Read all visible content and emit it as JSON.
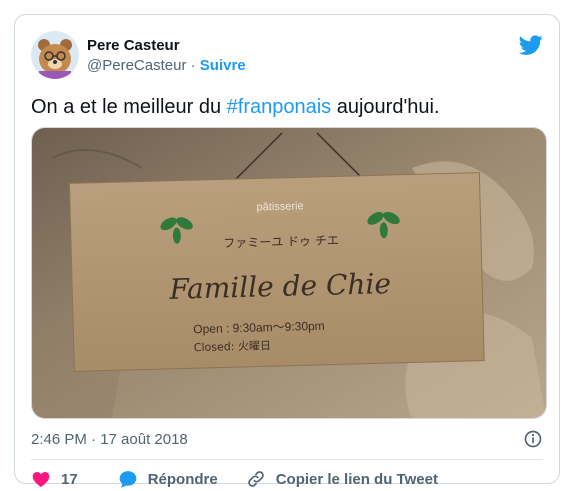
{
  "tweet": {
    "display_name": "Pere Casteur",
    "handle": "@PereCasteur",
    "separator": "·",
    "follow_label": "Suivre",
    "text_before": "On a et le meilleur du ",
    "hashtag": "#franponais",
    "text_after": " aujourd'hui.",
    "timestamp": "2:46 PM · 17 août 2018"
  },
  "photo": {
    "sign_small": "pâtisserie",
    "sign_katakana": "ファミーユ ドゥ チエ",
    "sign_title": "Famille de Chie",
    "sign_hours": "Open : 9:30am〜9:30pm",
    "sign_closed": "Closed: 火曜日"
  },
  "actions": {
    "like_count": "17",
    "reply_label": "Répondre",
    "copy_link_label": "Copier le lien du Tweet"
  },
  "colors": {
    "accent": "#1d9bf0",
    "like": "#f91880",
    "muted": "#536471"
  },
  "icons": [
    "avatar-bear",
    "twitter-bird-icon",
    "info-icon",
    "heart-icon",
    "reply-icon",
    "link-icon"
  ]
}
